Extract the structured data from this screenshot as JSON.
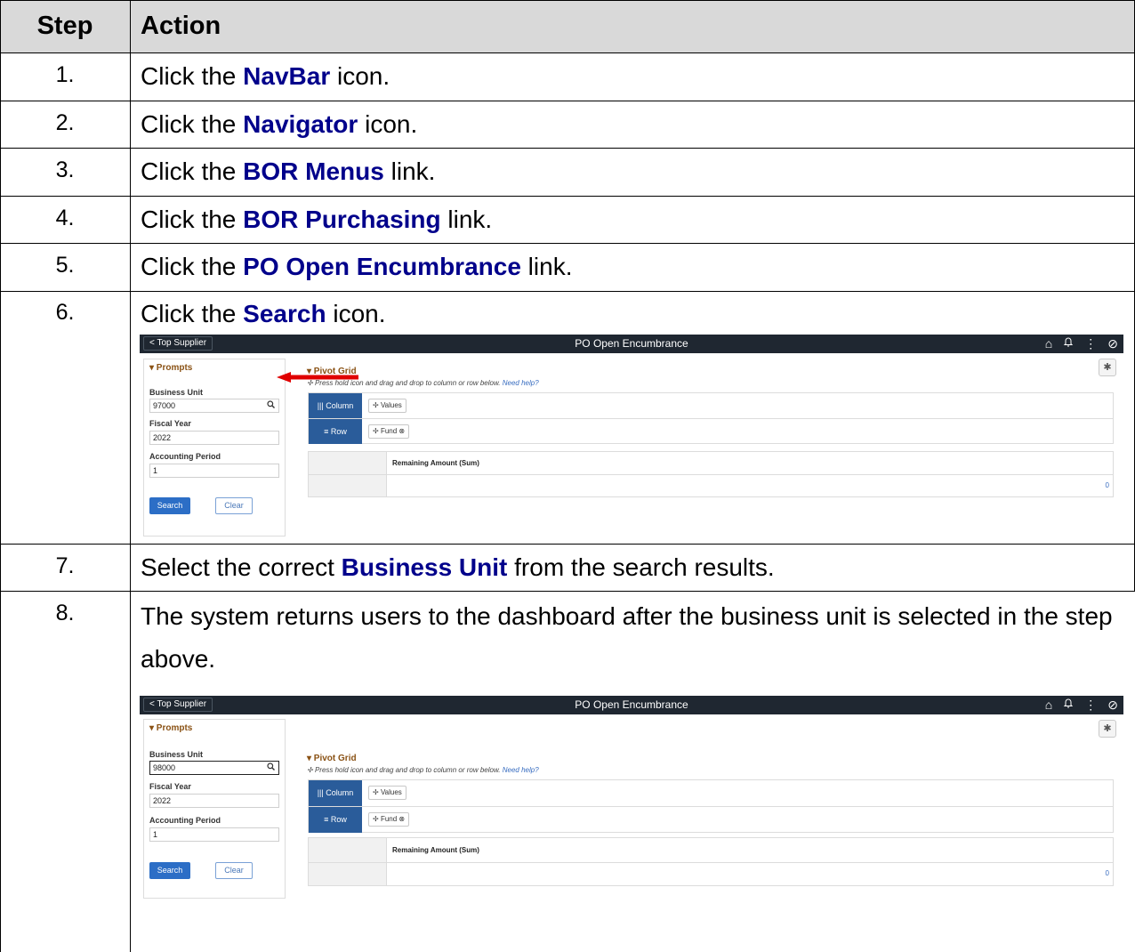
{
  "table": {
    "headers": {
      "step": "Step",
      "action": "Action"
    },
    "rows": [
      {
        "step": "1.",
        "pre": "Click the ",
        "kw": "NavBar",
        "post": " icon."
      },
      {
        "step": "2.",
        "pre": "Click the ",
        "kw": "Navigator",
        "post": " icon."
      },
      {
        "step": "3.",
        "pre": "Click the ",
        "kw": "BOR Menus",
        "post": " link."
      },
      {
        "step": "4.",
        "pre": "Click the ",
        "kw": "BOR Purchasing",
        "post": " link."
      },
      {
        "step": "5.",
        "pre": "Click the ",
        "kw": "PO Open Encumbrance",
        "post": " link."
      },
      {
        "step": "6.",
        "pre": "Click the ",
        "kw": "Search",
        "post": " icon."
      },
      {
        "step": "7.",
        "pre": "Select the correct ",
        "kw": "Business Unit",
        "post": " from the search results."
      },
      {
        "step": "8.",
        "text": "The system returns users to the dashboard after the business unit is selected in the step above."
      }
    ]
  },
  "screenshots": [
    {
      "back_label": "< Top Supplier",
      "page_title": "PO Open Encumbrance",
      "prompts_title": "▾ Prompts",
      "business_unit_label": "Business Unit",
      "business_unit_value": "97000",
      "fiscal_year_label": "Fiscal Year",
      "fiscal_year_value": "2022",
      "period_label": "Accounting Period",
      "period_value": "1",
      "search_label": "Search",
      "clear_label": "Clear",
      "pivot_title": "▾ Pivot Grid",
      "hint": "Press hold icon and drag and drop to column or row below.",
      "help": "Need help?",
      "column_label": "Column",
      "row_label": "Row",
      "values_chip": "Values",
      "fund_chip": "Fund",
      "grid_header": "Remaining Amount (Sum)",
      "grid_value": "0"
    },
    {
      "back_label": "< Top Supplier",
      "page_title": "PO Open Encumbrance",
      "prompts_title": "▾ Prompts",
      "business_unit_label": "Business Unit",
      "business_unit_value": "98000",
      "fiscal_year_label": "Fiscal Year",
      "fiscal_year_value": "2022",
      "period_label": "Accounting Period",
      "period_value": "1",
      "search_label": "Search",
      "clear_label": "Clear",
      "pivot_title": "▾ Pivot Grid",
      "hint": "Press hold icon and drag and drop to column or row below.",
      "help": "Need help?",
      "column_label": "Column",
      "row_label": "Row",
      "values_chip": "Values",
      "fund_chip": "Fund",
      "grid_header": "Remaining Amount (Sum)",
      "grid_value": "0"
    }
  ],
  "icons": {
    "home": "⌂",
    "bell": "♫",
    "kebab": "⋮",
    "compass": "⊘",
    "gear": "✱",
    "lookup": "⚲",
    "drag": "✢",
    "remove": "⊗",
    "column": "|||",
    "row": "≡"
  },
  "colors": {
    "keyword": "#00008b",
    "header_bg": "#d9d9d9",
    "topbar": "#1f2731",
    "primary_button": "#2c6ec6",
    "arrow": "#e00000"
  }
}
